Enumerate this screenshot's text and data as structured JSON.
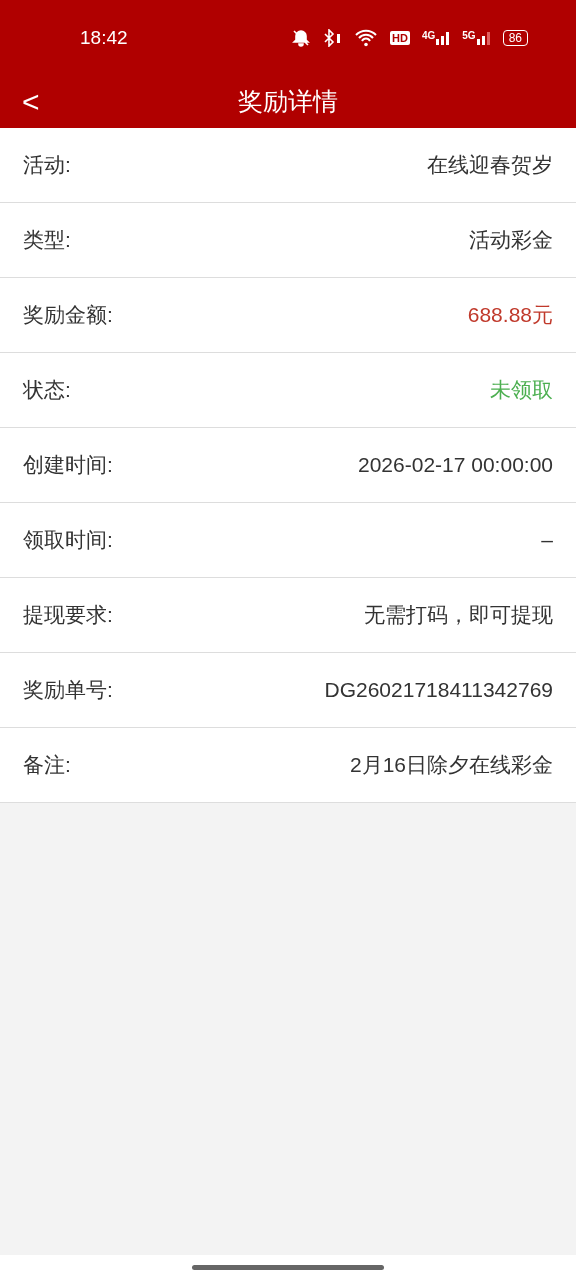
{
  "status_bar": {
    "time": "18:42",
    "hd": "HD",
    "network_1": "4G",
    "network_2": "5G",
    "battery": "86"
  },
  "nav": {
    "back": "<",
    "title": "奖励详情"
  },
  "rows": [
    {
      "label": "活动:",
      "value": "在线迎春贺岁",
      "kind": "plain"
    },
    {
      "label": "类型:",
      "value": "活动彩金",
      "kind": "plain"
    },
    {
      "label": "奖励金额:",
      "value": "688.88元",
      "kind": "money"
    },
    {
      "label": "状态:",
      "value": "未领取",
      "kind": "success"
    },
    {
      "label": "创建时间:",
      "value": "2026-02-17 00:00:00",
      "kind": "plain"
    },
    {
      "label": "领取时间:",
      "value": "–",
      "kind": "plain"
    },
    {
      "label": "提现要求:",
      "value": "无需打码，即可提现",
      "kind": "plain"
    },
    {
      "label": "奖励单号:",
      "value": "DG26021718411342769",
      "kind": "plain"
    },
    {
      "label": "备注:",
      "value": "2月16日除夕在线彩金",
      "kind": "plain"
    }
  ]
}
